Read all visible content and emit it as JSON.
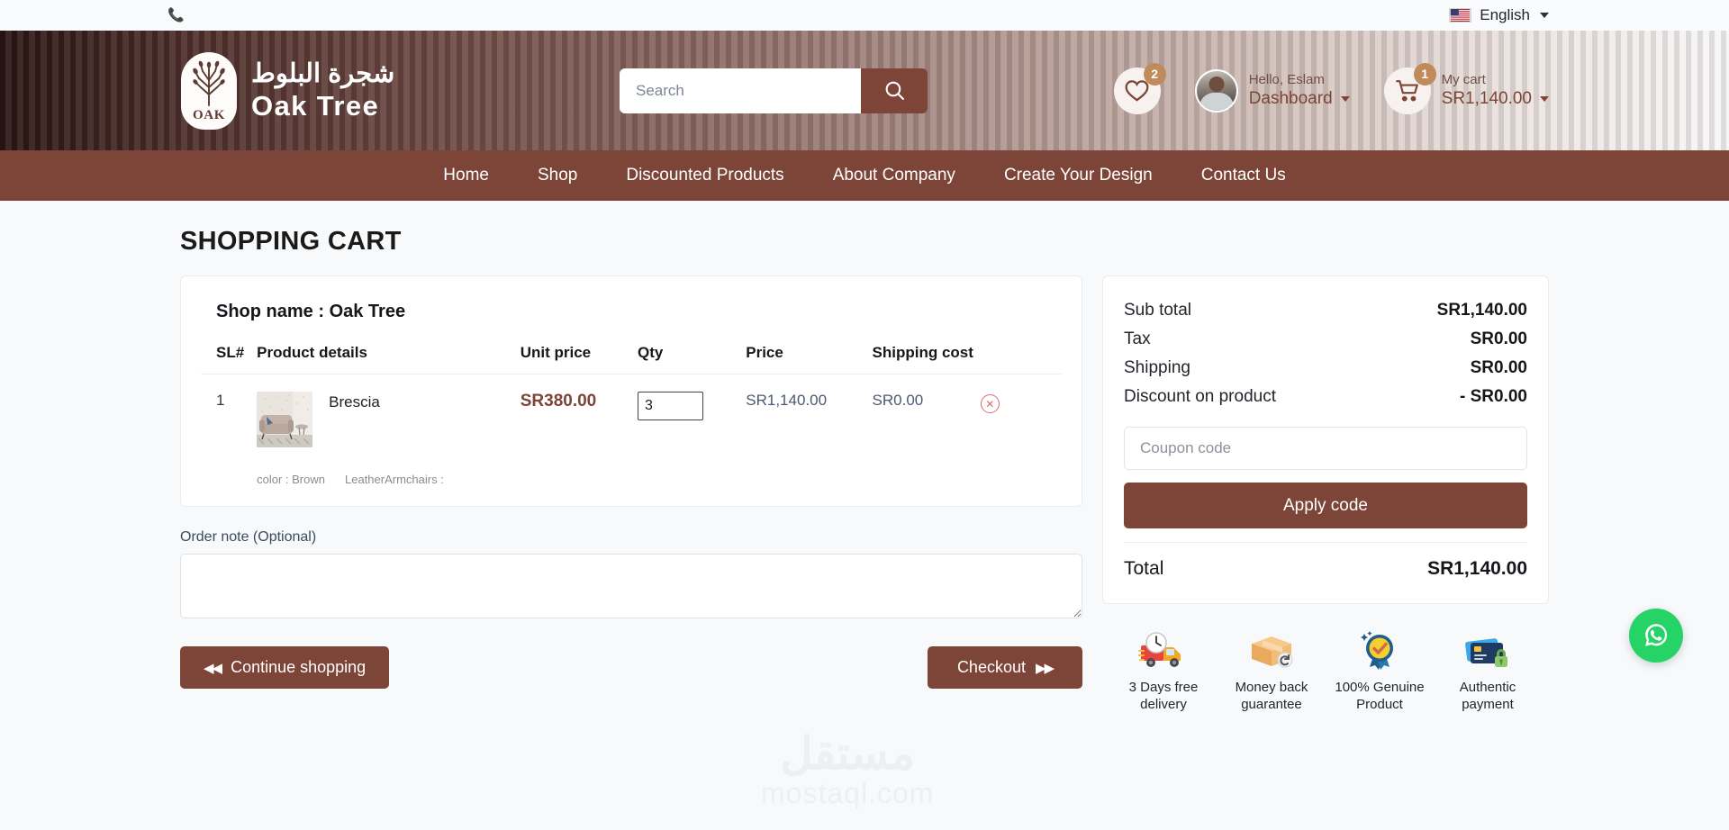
{
  "topbar": {
    "phone_icon": "phone-icon",
    "language": "English",
    "flag": "us-flag-icon"
  },
  "header": {
    "logo": {
      "mark_text": "OAK",
      "arabic_name": "شجرة البلوط",
      "english_name": "Oak Tree"
    },
    "search": {
      "placeholder": "Search",
      "value": "",
      "button_icon": "search-icon"
    },
    "wishlist": {
      "icon": "heart-icon",
      "badge": "2"
    },
    "account": {
      "greeting": "Hello, Eslam",
      "menu_label": "Dashboard",
      "avatar": "user-avatar"
    },
    "cart": {
      "icon": "cart-icon",
      "badge": "1",
      "label": "My cart",
      "amount": "SR1,140.00"
    }
  },
  "nav": {
    "items": [
      {
        "label": "Home"
      },
      {
        "label": "Shop"
      },
      {
        "label": "Discounted Products"
      },
      {
        "label": "About Company"
      },
      {
        "label": "Create Your Design"
      },
      {
        "label": "Contact Us"
      }
    ]
  },
  "page": {
    "title": "SHOPPING CART"
  },
  "cart": {
    "shop_name": "Shop name : Oak Tree",
    "columns": {
      "sl": "SL#",
      "product": "Product details",
      "unit_price": "Unit price",
      "qty": "Qty",
      "price": "Price",
      "shipping_cost": "Shipping cost"
    },
    "rows": [
      {
        "sl": "1",
        "name": "Brescia",
        "thumb": "armchair-photo",
        "meta_color": "color : Brown",
        "meta_material": "LeatherArmchairs :",
        "unit_price": "SR380.00",
        "qty": "3",
        "price": "SR1,140.00",
        "shipping_cost": "SR0.00",
        "remove_icon": "remove-circle-icon"
      }
    ],
    "note_label": "Order note (Optional)",
    "note_value": "",
    "continue_label": "Continue shopping",
    "checkout_label": "Checkout"
  },
  "summary": {
    "rows": [
      {
        "label": "Sub total",
        "value": "SR1,140.00"
      },
      {
        "label": "Tax",
        "value": "SR0.00"
      },
      {
        "label": "Shipping",
        "value": "SR0.00"
      },
      {
        "label": "Discount on product",
        "value": "- SR0.00"
      }
    ],
    "coupon_placeholder": "Coupon code",
    "coupon_value": "",
    "apply_label": "Apply code",
    "total_label": "Total",
    "total_value": "SR1,140.00"
  },
  "trust_badges": [
    {
      "icon": "delivery-truck-icon",
      "line1": "3 Days free",
      "line2": "delivery"
    },
    {
      "icon": "money-back-box-icon",
      "line1": "Money back",
      "line2": "guarantee"
    },
    {
      "icon": "genuine-badge-icon",
      "line1": "100% Genuine",
      "line2": "Product"
    },
    {
      "icon": "secure-payment-icon",
      "line1": "Authentic",
      "line2": "payment"
    }
  ],
  "watermark": {
    "arabic": "مستقل",
    "latin": "mostaql.com"
  },
  "floating": {
    "whatsapp_icon": "whatsapp-icon"
  },
  "colors": {
    "brand_brown": "#7d4438",
    "badge_gold": "#c08a5a",
    "whatsapp_green": "#25d366",
    "remove_red": "#e06b6b"
  }
}
